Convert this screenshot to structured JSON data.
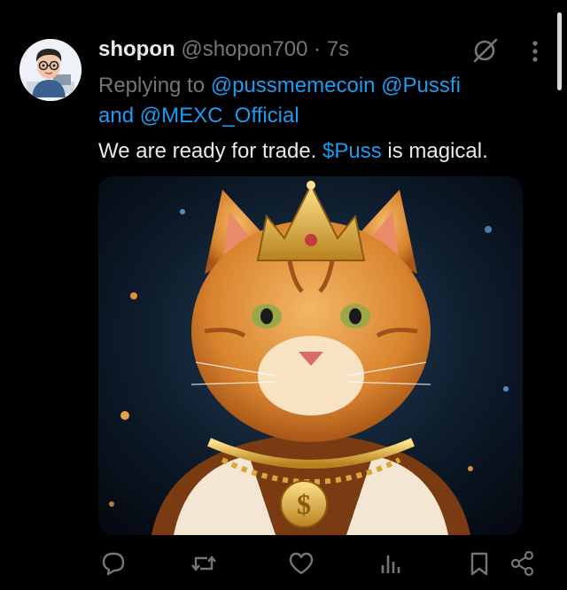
{
  "tweet": {
    "author_name": "shopon",
    "author_handle": "@shopon700",
    "separator": " · ",
    "time_ago": "7s",
    "replying_prefix": "Replying to ",
    "mention_1": "@pussmemecoin",
    "mention_2": "@Pussfi",
    "and_word": "and ",
    "mention_3": "@MEXC_Official",
    "text_before": "We are ready for trade. ",
    "cashtag": "$Puss",
    "text_after": " is magical."
  },
  "actions": [
    "reply-icon",
    "retweet-icon",
    "like-icon",
    "views-icon",
    "bookmark-icon",
    "share-icon"
  ],
  "colors": {
    "background": "#000000",
    "text": "#e7e9ea",
    "muted": "#71767b",
    "link": "#1d9bf0"
  }
}
